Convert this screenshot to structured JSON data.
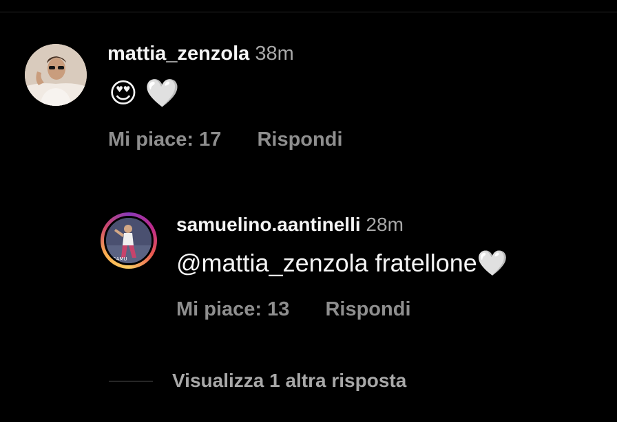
{
  "comment": {
    "username": "mattia_zenzola",
    "time": "38m",
    "emoji_1": "😍",
    "emoji_2": "🤍",
    "likes_label": "Mi piace: 17",
    "reply_label": "Rispondi"
  },
  "reply": {
    "username": "samuelino.aantinelli",
    "time": "28m",
    "text": "@mattia_zenzola fratellone",
    "emoji": "🤍",
    "likes_label": "Mi piace: 13",
    "reply_label": "Rispondi"
  },
  "view_more_label": "Visualizza 1 altra risposta",
  "colors": {
    "background": "#000000",
    "text": "#f5f5f5",
    "secondary": "#8e8e8e"
  }
}
